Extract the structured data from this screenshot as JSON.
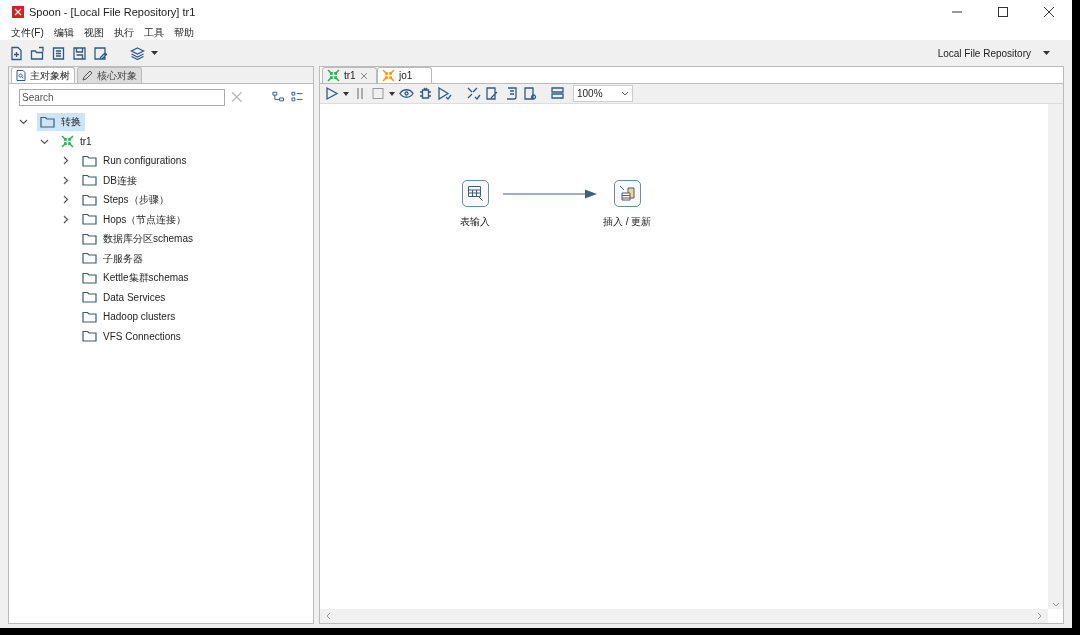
{
  "window": {
    "title": "Spoon - [Local File Repository] tr1"
  },
  "menu": [
    "文件(F)",
    "编辑",
    "视图",
    "执行",
    "工具",
    "帮助"
  ],
  "repository": {
    "label": "Local File Repository"
  },
  "left_tabs": [
    {
      "label": "主对象树",
      "selected": true
    },
    {
      "label": "核心对象",
      "selected": false
    }
  ],
  "search": {
    "placeholder": "Search"
  },
  "tree": [
    {
      "label": "转换",
      "kind": "folder",
      "selected": true,
      "expanded": true,
      "children": [
        {
          "label": "tr1",
          "kind": "transformation",
          "selected": false,
          "expanded": true,
          "children": [
            {
              "label": "Run configurations",
              "kind": "folder",
              "selected": false,
              "expanded": false
            },
            {
              "label": "DB连接",
              "kind": "folder",
              "selected": false,
              "expanded": false
            },
            {
              "label": "Steps（步骤）",
              "kind": "folder",
              "selected": false,
              "expanded": false
            },
            {
              "label": "Hops（节点连接）",
              "kind": "folder",
              "selected": false,
              "expanded": false
            },
            {
              "label": "数据库分区schemas",
              "kind": "folder",
              "selected": false
            },
            {
              "label": "子服务器",
              "kind": "folder",
              "selected": false
            },
            {
              "label": "Kettle集群schemas",
              "kind": "folder",
              "selected": false
            },
            {
              "label": "Data Services",
              "kind": "folder",
              "selected": false
            },
            {
              "label": "Hadoop clusters",
              "kind": "folder",
              "selected": false
            },
            {
              "label": "VFS Connections",
              "kind": "folder",
              "selected": false
            }
          ]
        }
      ]
    }
  ],
  "editor_tabs": [
    {
      "label": "tr1",
      "kind": "transformation",
      "selected": true
    },
    {
      "label": "jo1",
      "kind": "job",
      "selected": false
    }
  ],
  "zoom": {
    "value": "100%"
  },
  "canvas": {
    "steps": [
      {
        "label": "表输入",
        "kind": "table-input"
      },
      {
        "label": "插入 / 更新",
        "kind": "insert-update"
      }
    ]
  }
}
